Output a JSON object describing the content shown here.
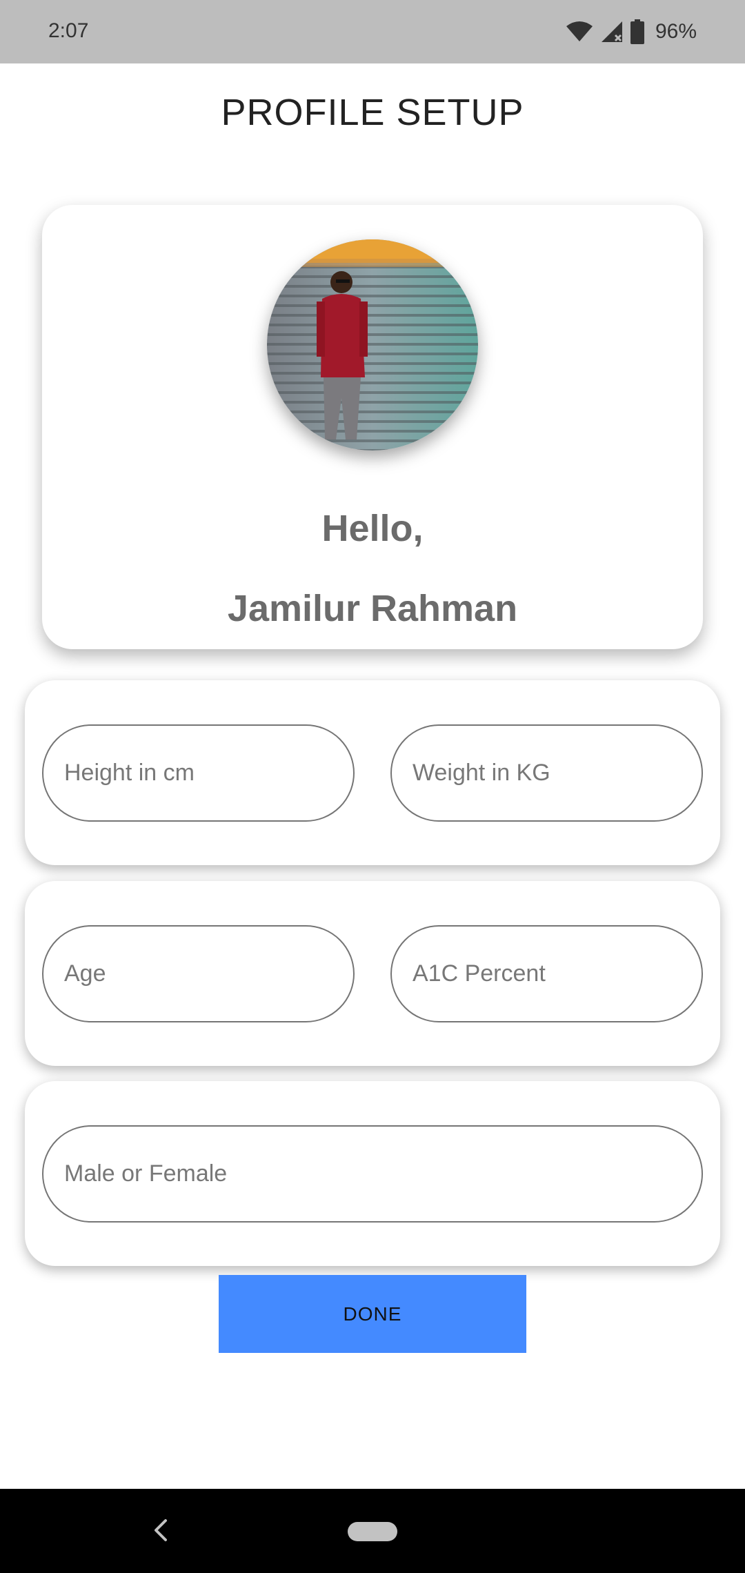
{
  "status_bar": {
    "time": "2:07",
    "battery_percent": "96%",
    "icons": [
      "wifi-icon",
      "signal-icon",
      "battery-icon"
    ]
  },
  "page": {
    "title": "PROFILE SETUP"
  },
  "profile": {
    "greeting": "Hello,",
    "name": "Jamilur Rahman"
  },
  "form": {
    "height_placeholder": "Height in cm",
    "weight_placeholder": "Weight in KG",
    "age_placeholder": "Age",
    "a1c_placeholder": "A1C Percent",
    "gender_placeholder": "Male or Female"
  },
  "actions": {
    "done_label": "DONE"
  },
  "colors": {
    "status_bar_bg": "#bdbdbd",
    "done_button_bg": "#448aff",
    "nav_bar_bg": "#000000",
    "text_grey": "#6b6b6b"
  }
}
